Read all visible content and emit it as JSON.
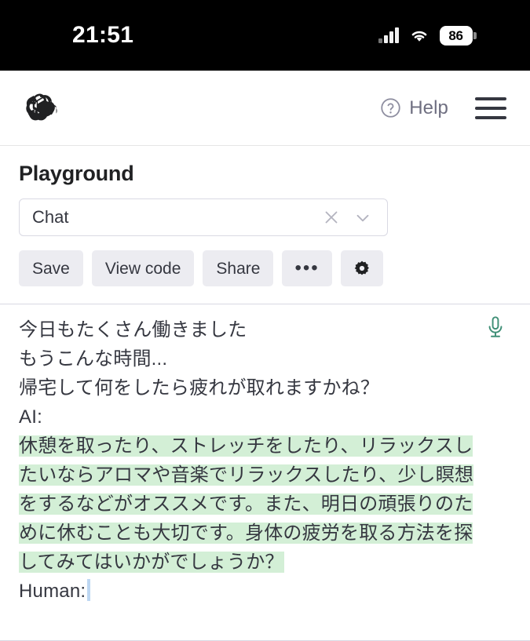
{
  "status_bar": {
    "time": "21:51",
    "battery_level": "86",
    "signal_icon": "cellular-bars-icon",
    "wifi_icon": "wifi-icon",
    "battery_icon": "battery-icon"
  },
  "header": {
    "logo_icon": "openai-logo-icon",
    "help_icon": "question-mark-circle-icon",
    "help_label": "Help",
    "menu_icon": "hamburger-menu-icon"
  },
  "toolbar": {
    "page_title": "Playground",
    "preset": {
      "value": "Chat",
      "clear_icon": "close-x-icon",
      "chevron_icon": "chevron-down-icon"
    },
    "buttons": [
      {
        "label": "Save",
        "name": "save-button"
      },
      {
        "label": "View code",
        "name": "view-code-button"
      },
      {
        "label": "Share",
        "name": "share-button"
      },
      {
        "label": "•••",
        "name": "more-options-button"
      }
    ],
    "settings_icon": "gear-icon"
  },
  "editor": {
    "mic_icon": "microphone-icon",
    "prompt_lines": [
      "今日もたくさん働きました",
      "もうこんな時間...",
      "帰宅して何をしたら疲れが取れますかね？",
      "AI:"
    ],
    "prompt_text": "今日もたくさん働きました\nもうこんな時間...\n帰宅して何をしたら疲れが取れますかね？\nAI:\n",
    "completion_text": "休憩を取ったり、ストレッチをしたり、リラックスしたいならアロマや音楽でリラックスしたり、少し瞑想をするなどがオススメです。また、明日の頑張りのために休むことも大切です。身体の疲労を取る方法を探してみてはいかがでしょうか？",
    "trailing_label": "Human:",
    "highlight_color": "#d3efd6",
    "caret_color": "#bdd7f2"
  }
}
